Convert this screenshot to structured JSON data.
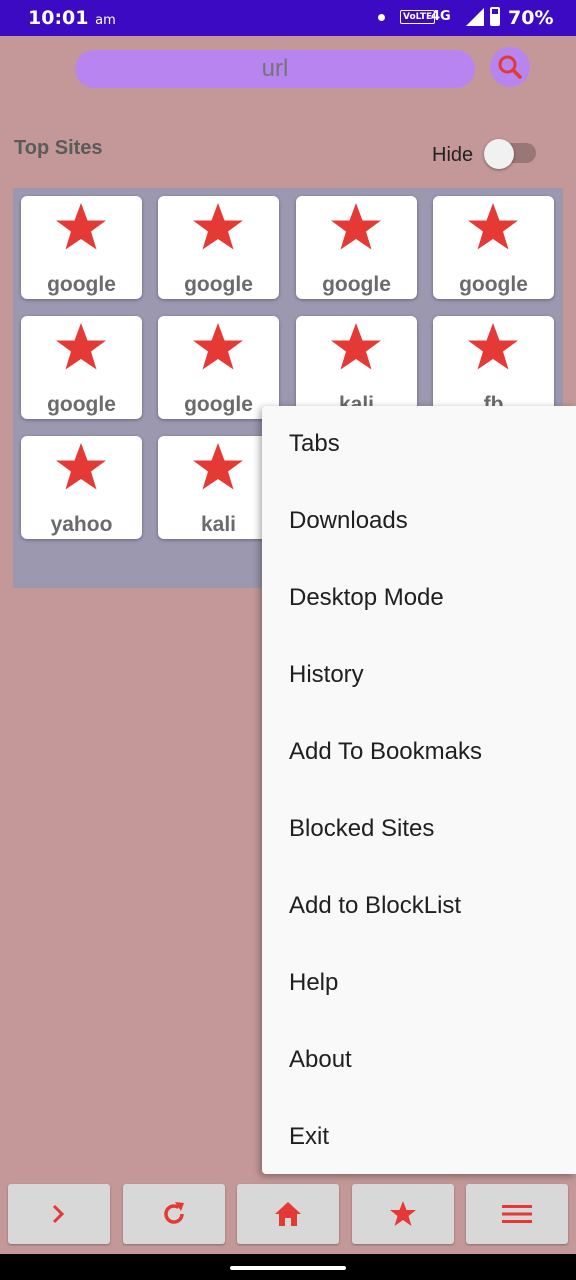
{
  "status_bar": {
    "time": "10:01",
    "ampm": "am",
    "volte": "VoLTE",
    "network": "4G",
    "battery": "70%",
    "battery_level": 0.7
  },
  "search": {
    "placeholder": "url"
  },
  "top_sites": {
    "title": "Top Sites",
    "hide_label": "Hide",
    "hide_toggle_on": false,
    "tiles": [
      {
        "label": "google",
        "icon": "star-icon"
      },
      {
        "label": "google",
        "icon": "star-icon"
      },
      {
        "label": "google",
        "icon": "star-icon"
      },
      {
        "label": "google",
        "icon": "star-icon"
      },
      {
        "label": "google",
        "icon": "star-icon"
      },
      {
        "label": "google",
        "icon": "star-icon"
      },
      {
        "label": "kali",
        "icon": "star-icon"
      },
      {
        "label": "fb",
        "icon": "star-icon"
      },
      {
        "label": "yahoo",
        "icon": "star-icon"
      },
      {
        "label": "kali",
        "icon": "star-icon"
      }
    ]
  },
  "menu": {
    "items": [
      {
        "label": "Tabs"
      },
      {
        "label": "Downloads"
      },
      {
        "label": "Desktop Mode"
      },
      {
        "label": "History"
      },
      {
        "label": "Add To Bookmaks"
      },
      {
        "label": "Blocked Sites"
      },
      {
        "label": "Add to BlockList"
      },
      {
        "label": "Help"
      },
      {
        "label": "About"
      },
      {
        "label": "Exit"
      }
    ]
  },
  "bottom_bar": {
    "buttons": [
      {
        "icon": "chevron-right-icon"
      },
      {
        "icon": "refresh-icon"
      },
      {
        "icon": "home-icon"
      },
      {
        "icon": "star-icon"
      },
      {
        "icon": "menu-icon"
      }
    ]
  },
  "colors": {
    "background": "#c49898",
    "status_bar": "#3c0ac2",
    "accent_purple": "#b884f0",
    "icon_red": "#e53935",
    "panel": "#9b98b0",
    "menu_bg": "#f9f9f9"
  }
}
